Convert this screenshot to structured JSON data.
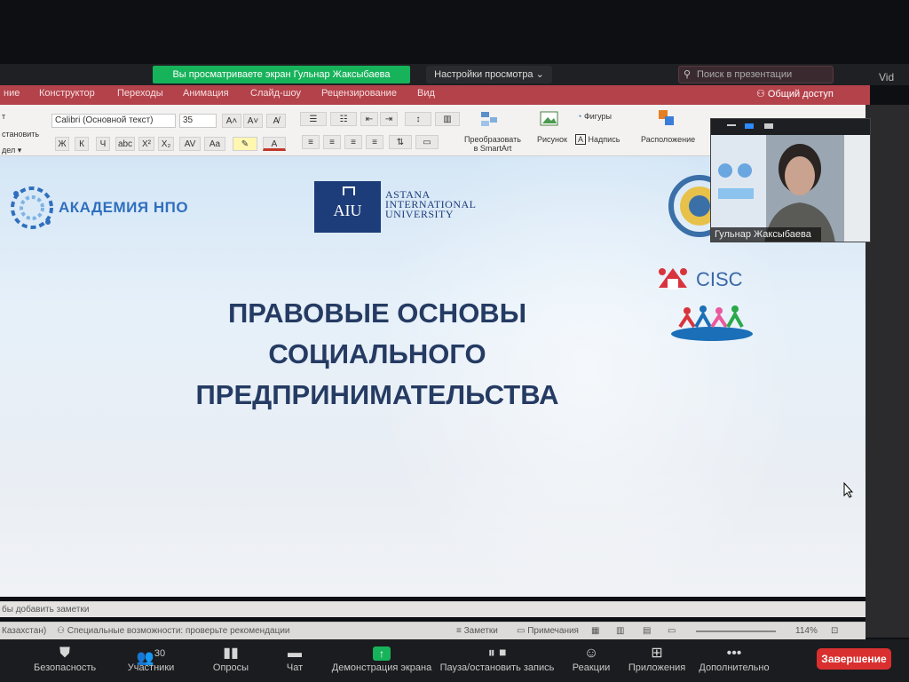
{
  "zoom_top": {
    "share_banner": "Вы просматриваете экран Гульнар Жаксыбаева",
    "view_options": "Настройки просмотра ⌄",
    "search_placeholder": "Поиск в презентации",
    "side_text": "Vid"
  },
  "ppt_menu": {
    "items": [
      "ние",
      "Конструктор",
      "Переходы",
      "Анимация",
      "Слайд-шоу",
      "Рецензирование",
      "Вид"
    ],
    "share": "Общий доступ"
  },
  "ribbon": {
    "font_name": "Calibri (Основной текст)",
    "font_size": "35",
    "left_labels": [
      "т",
      "становить",
      "дел ▾"
    ],
    "smartart_label": "Преобразовать в SmartArt",
    "picture_label": "Рисунок",
    "shapes_label": "Фигуры",
    "textbox_label": "Надпись",
    "arrange_label": "Расположение",
    "format_buttons": [
      "Ж",
      "К",
      "Ч",
      "abc",
      "X²",
      "X₂",
      "AV",
      "Aa"
    ]
  },
  "slide": {
    "acad_text": "АКАДЕМИЯ НПО",
    "aiu_abbr": "AIU",
    "aiu_name_lines": [
      "ASTANA",
      "INTERNATIONAL",
      "UNIVERSITY"
    ],
    "title_lines": [
      "ПРАВОВЫЕ ОСНОВЫ",
      "СОЦИАЛЬНОГО",
      "ПРЕДПРИНИМАТЕЛЬСТВА"
    ],
    "cisc_text": "CISC"
  },
  "webcam": {
    "name": "Гульнар Жаксыбаева"
  },
  "notes": {
    "placeholder": "бы добавить заметки"
  },
  "status": {
    "left": "Казахстан)",
    "accessibility": "Специальные возможности: проверьте рекомендации",
    "notes_btn": "Заметки",
    "comments_btn": "Примечания",
    "zoom_level": "114%"
  },
  "toolbar": {
    "security": "Безопасность",
    "participants": "Участники",
    "participants_count": "30",
    "polls": "Опросы",
    "chat": "Чат",
    "share_screen": "Демонстрация экрана",
    "pause_record": "Пауза/остановить запись",
    "reactions": "Реакции",
    "apps": "Приложения",
    "more": "Дополнительно",
    "end": "Завершение"
  },
  "colors": {
    "share_green": "#17b35a",
    "ppt_red": "#b3424b",
    "end_red": "#d9302f",
    "title_navy": "#253b63"
  }
}
